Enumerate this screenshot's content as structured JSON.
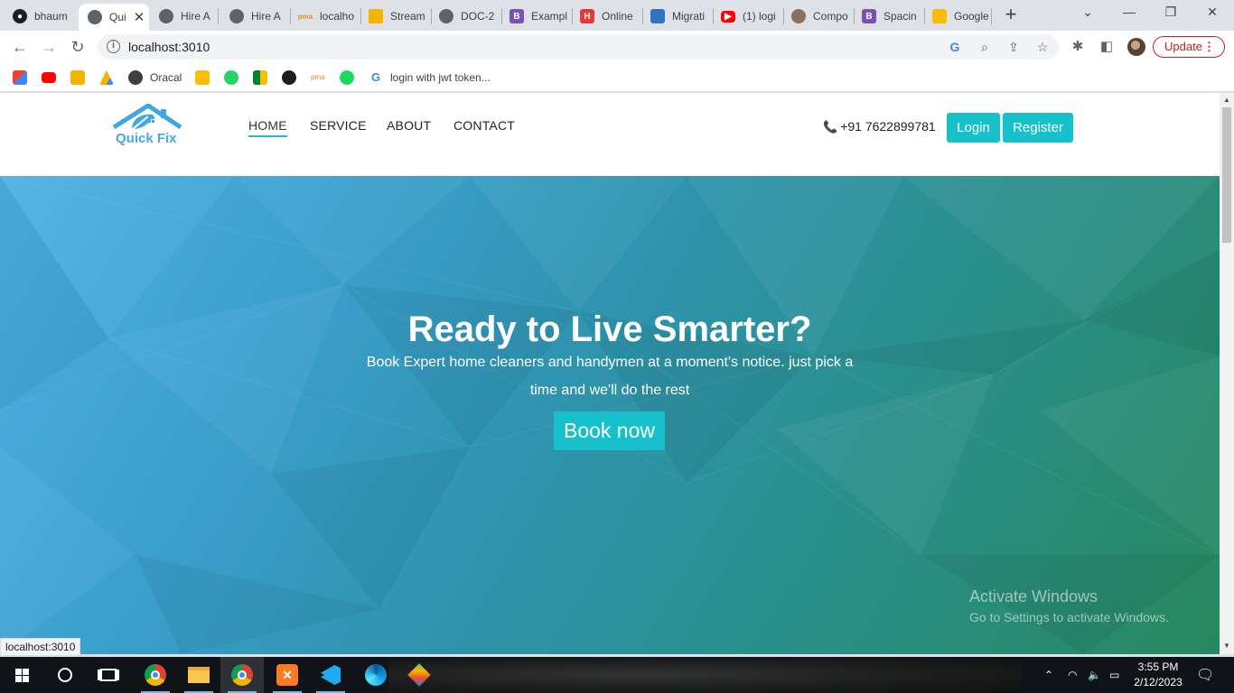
{
  "browser": {
    "tabs": [
      {
        "title": "bhaum",
        "icon": "github-icon",
        "active": false
      },
      {
        "title": "Qui",
        "icon": "globe-icon",
        "active": true
      },
      {
        "title": "Hire A",
        "icon": "globe-icon",
        "active": false
      },
      {
        "title": "Hire A",
        "icon": "globe-icon",
        "active": false
      },
      {
        "title": "localho",
        "icon": "phpmyadmin-icon",
        "active": false
      },
      {
        "title": "Stream",
        "icon": "classroom-icon",
        "active": false
      },
      {
        "title": "DOC-2",
        "icon": "globe-icon",
        "active": false
      },
      {
        "title": "Exampl",
        "icon": "bootstrap-icon",
        "active": false
      },
      {
        "title": "Online",
        "icon": "h-icon",
        "active": false
      },
      {
        "title": "Migrati",
        "icon": "cube-icon",
        "active": false
      },
      {
        "title": "(1) logi",
        "icon": "youtube-icon",
        "active": false
      },
      {
        "title": "Compo",
        "icon": "component-icon",
        "active": false
      },
      {
        "title": "Spacin",
        "icon": "bootstrap-icon",
        "active": false
      },
      {
        "title": "Google",
        "icon": "keep-icon",
        "active": false
      }
    ],
    "url": "localhost:3010",
    "update_label": "Update",
    "bookmarks": [
      {
        "label": "",
        "icon": "gmail-icon"
      },
      {
        "label": "",
        "icon": "youtube-icon"
      },
      {
        "label": "",
        "icon": "classroom-icon"
      },
      {
        "label": "",
        "icon": "drive-icon"
      },
      {
        "label": "Oracal",
        "icon": "globe-icon"
      },
      {
        "label": "",
        "icon": "keep-icon"
      },
      {
        "label": "",
        "icon": "whatsapp-icon"
      },
      {
        "label": "",
        "icon": "meet-icon"
      },
      {
        "label": "",
        "icon": "github-icon"
      },
      {
        "label": "",
        "icon": "phpmyadmin-icon"
      },
      {
        "label": "",
        "icon": "spotify-icon"
      },
      {
        "label": "login with jwt token...",
        "icon": "google-icon"
      }
    ],
    "status_url": "localhost:3010"
  },
  "site": {
    "logo_text": "Quick Fix",
    "nav": [
      {
        "label": "HOME",
        "active": true
      },
      {
        "label": "SERVICE",
        "active": false
      },
      {
        "label": "ABOUT",
        "active": false
      },
      {
        "label": "CONTACT",
        "active": false
      }
    ],
    "phone": "+91 7622899781",
    "login_label": "Login",
    "register_label": "Register",
    "accent_color": "#17c1cb",
    "hero": {
      "title": "Ready to Live Smarter?",
      "subtitle": "Book Expert home cleaners and handymen at a moment's notice. just pick a time and we'll do the rest",
      "cta_label": "Book now"
    }
  },
  "watermark": {
    "line1": "Activate Windows",
    "line2": "Go to Settings to activate Windows."
  },
  "taskbar": {
    "apps": [
      "start-icon",
      "search-icon",
      "task-view-icon",
      "chrome-icon",
      "file-explorer-icon",
      "chrome-icon",
      "xampp-icon",
      "vscode-icon",
      "edge-icon",
      "git-icon"
    ],
    "time": "3:55 PM",
    "date": "2/12/2023"
  }
}
